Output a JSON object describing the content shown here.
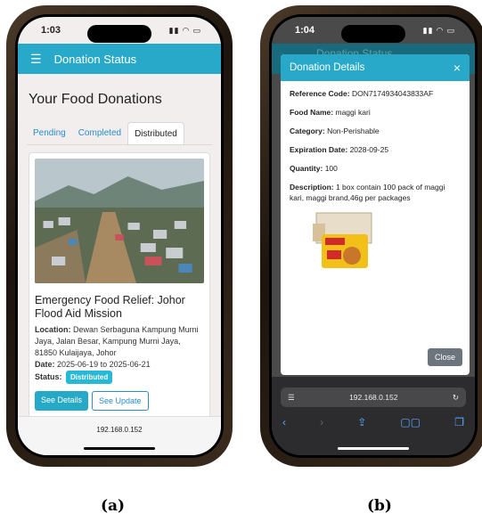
{
  "left": {
    "time": "1:03",
    "appbar_title": "Donation Status",
    "page_title": "Your Food Donations",
    "tabs": [
      "Pending",
      "Completed",
      "Distributed"
    ],
    "card": {
      "title": "Emergency Food Relief: Johor Flood Aid Mission",
      "location_label": "Location:",
      "location": "Dewan Serbaguna Kampung Murni Jaya, Jalan Besar, Kampung Murni Jaya, 81850 Kulaijaya, Johor",
      "date_label": "Date:",
      "date": "2025-06-19 to 2025-06-21",
      "status_label": "Status:",
      "status": "Distributed",
      "details_button": "See Details",
      "update_button": "See Update"
    },
    "url": "192.168.0.152"
  },
  "right": {
    "time": "1:04",
    "bg_title": "Donation Status",
    "modal_title": "Donation Details",
    "close_x": "×",
    "reference_label": "Reference Code:",
    "reference": "DON7174934043833AF",
    "food_label": "Food Name:",
    "food": "maggi kari",
    "category_label": "Category:",
    "category": "Non-Perishable",
    "expiry_label": "Expiration Date:",
    "expiry": "2028-09-25",
    "quantity_label": "Quantity:",
    "quantity": "100",
    "description_label": "Description:",
    "description": "1 box contain 100 pack of maggi kari, maggi brand,46g per packages",
    "close_button": "Close",
    "url": "192.168.0.152"
  },
  "captions": [
    "(a)",
    "(b)"
  ],
  "colors": {
    "primary": "#28a9c9",
    "link": "#2a8ec9",
    "close": "#6c757d"
  }
}
